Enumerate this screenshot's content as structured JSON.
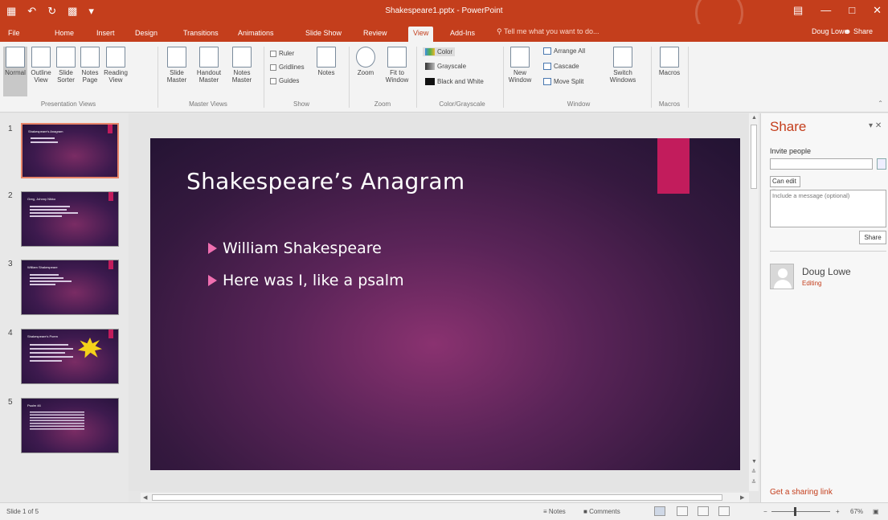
{
  "window": {
    "title": "Shakespeare1.pptx - PowerPoint",
    "user": "Doug Lowe",
    "share_label": "Share"
  },
  "tabs": [
    {
      "label": "File"
    },
    {
      "label": "Home"
    },
    {
      "label": "Insert"
    },
    {
      "label": "Design"
    },
    {
      "label": "Transitions"
    },
    {
      "label": "Animations"
    },
    {
      "label": "Slide Show"
    },
    {
      "label": "Review"
    },
    {
      "label": "View"
    },
    {
      "label": "Add-Ins"
    }
  ],
  "active_tab": "View",
  "tell_me": "Tell me what you want to do...",
  "ribbon": {
    "presentation_views": {
      "label": "Presentation Views",
      "buttons": [
        "Normal",
        "Outline View",
        "Slide Sorter",
        "Notes Page",
        "Reading View"
      ]
    },
    "master_views": {
      "label": "Master Views",
      "buttons": [
        "Slide Master",
        "Handout Master",
        "Notes Master"
      ]
    },
    "show": {
      "label": "Show",
      "checks": [
        "Ruler",
        "Gridlines",
        "Guides"
      ],
      "notes": "Notes"
    },
    "zoom": {
      "label": "Zoom",
      "buttons": [
        "Zoom",
        "Fit to Window"
      ]
    },
    "color": {
      "label": "Color/Grayscale",
      "items": [
        "Color",
        "Grayscale",
        "Black and White"
      ]
    },
    "window": {
      "label": "Window",
      "new_window": "New Window",
      "items": [
        "Arrange All",
        "Cascade",
        "Move Split"
      ],
      "switch": "Switch Windows"
    },
    "macros": {
      "label": "Macros",
      "button": "Macros"
    }
  },
  "thumbnails": [
    {
      "num": "1",
      "title": "Shakespeare's Anagram"
    },
    {
      "num": "2",
      "title": "Greg, Johnny Nikko"
    },
    {
      "num": "3",
      "title": "William Shakespeare"
    },
    {
      "num": "4",
      "title": "Shakespeare's Poem"
    },
    {
      "num": "5",
      "title": "Psalm 46"
    }
  ],
  "slide": {
    "title": "Shakespeare’s Anagram",
    "bullets": [
      "William Shakespeare",
      "Here was I, like a psalm"
    ]
  },
  "share_pane": {
    "title": "Share",
    "invite_label": "Invite people",
    "permission": "Can edit",
    "message_placeholder": "Include a message (optional)",
    "share_button": "Share",
    "person_name": "Doug Lowe",
    "person_status": "Editing",
    "link": "Get a sharing link"
  },
  "status": {
    "slide_info": "Slide 1 of 5",
    "notes": "Notes",
    "comments": "Comments",
    "zoom": "67%"
  },
  "colors": {
    "accent": "#c43e1c",
    "slide_accent": "#c21c5c",
    "bullet": "#f06fb0"
  }
}
